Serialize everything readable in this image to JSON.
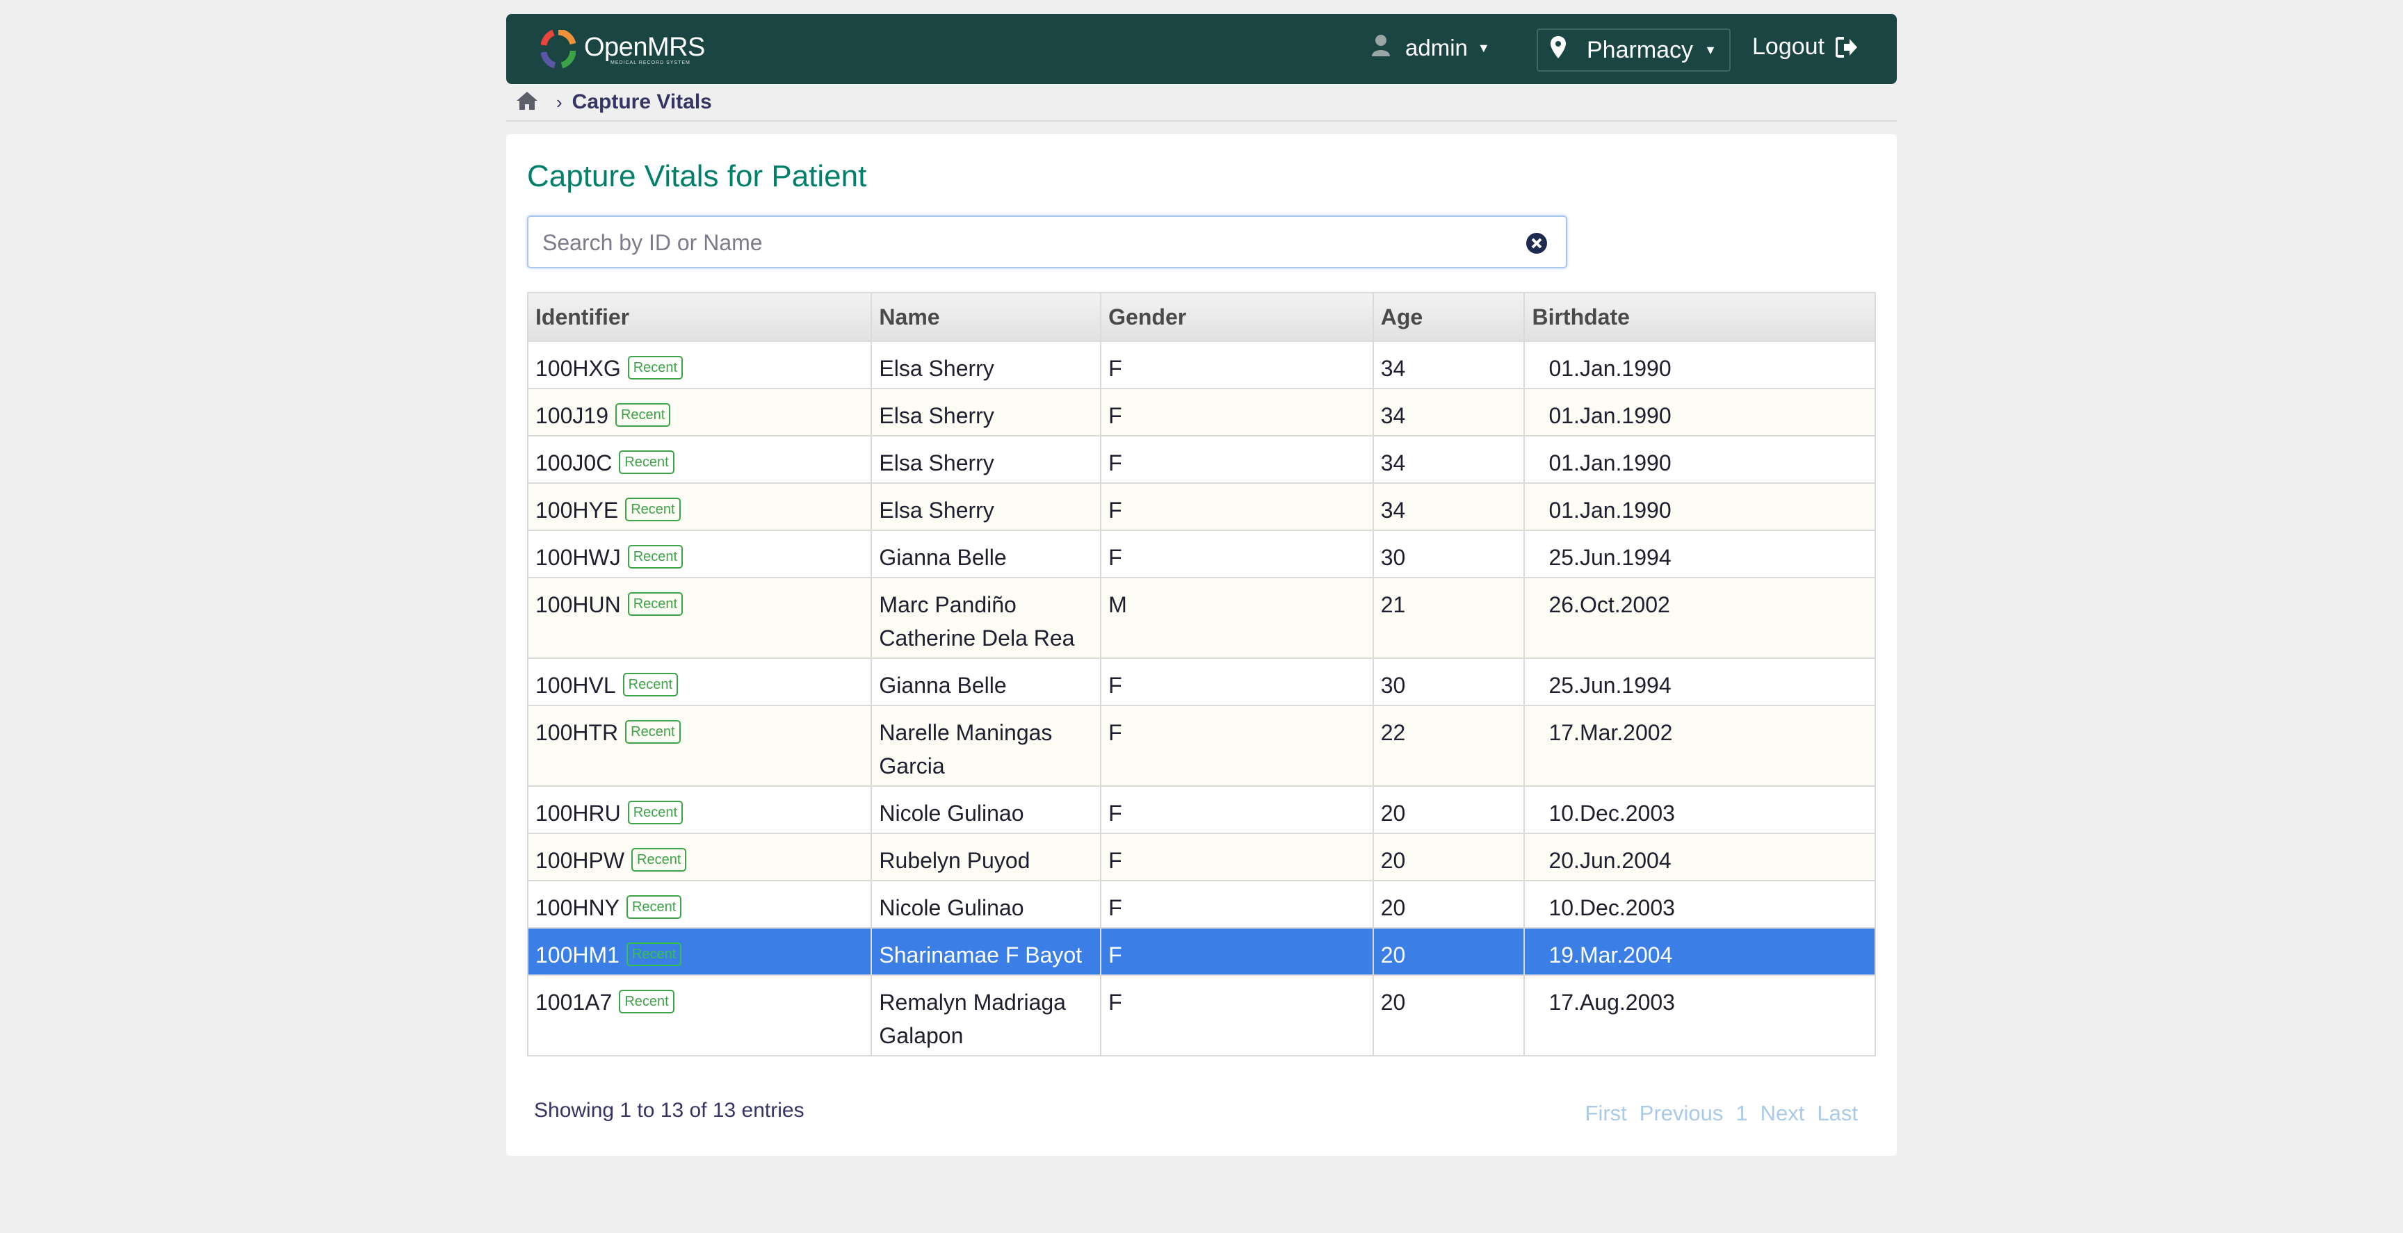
{
  "header": {
    "logo_text": "OpenMRS",
    "logo_tagline": "MEDICAL RECORD SYSTEM",
    "user": "admin",
    "location": "Pharmacy",
    "logout": "Logout"
  },
  "breadcrumb": {
    "current": "Capture Vitals"
  },
  "page": {
    "title": "Capture Vitals for Patient",
    "search_placeholder": "Search by ID or Name"
  },
  "table": {
    "headers": [
      "Identifier",
      "Name",
      "Gender",
      "Age",
      "Birthdate"
    ],
    "badge": "Recent",
    "rows": [
      {
        "id": "100HXG",
        "name": "Elsa Sherry",
        "gender": "F",
        "age": "34",
        "birthdate": "01.Jan.1990"
      },
      {
        "id": "100J19",
        "name": "Elsa Sherry",
        "gender": "F",
        "age": "34",
        "birthdate": "01.Jan.1990"
      },
      {
        "id": "100J0C",
        "name": "Elsa Sherry",
        "gender": "F",
        "age": "34",
        "birthdate": "01.Jan.1990"
      },
      {
        "id": "100HYE",
        "name": "Elsa Sherry",
        "gender": "F",
        "age": "34",
        "birthdate": "01.Jan.1990"
      },
      {
        "id": "100HWJ",
        "name": "Gianna Belle",
        "gender": "F",
        "age": "30",
        "birthdate": "25.Jun.1994"
      },
      {
        "id": "100HUN",
        "name": "Marc Pandiño Catherine Dela Rea",
        "gender": "M",
        "age": "21",
        "birthdate": "26.Oct.2002"
      },
      {
        "id": "100HVL",
        "name": "Gianna Belle",
        "gender": "F",
        "age": "30",
        "birthdate": "25.Jun.1994"
      },
      {
        "id": "100HTR",
        "name": "Narelle Maningas Garcia",
        "gender": "F",
        "age": "22",
        "birthdate": "17.Mar.2002"
      },
      {
        "id": "100HRU",
        "name": "Nicole Gulinao",
        "gender": "F",
        "age": "20",
        "birthdate": "10.Dec.2003"
      },
      {
        "id": "100HPW",
        "name": "Rubelyn Puyod",
        "gender": "F",
        "age": "20",
        "birthdate": "20.Jun.2004"
      },
      {
        "id": "100HNY",
        "name": "Nicole Gulinao",
        "gender": "F",
        "age": "20",
        "birthdate": "10.Dec.2003"
      },
      {
        "id": "100HM1",
        "name": "Sharinamae F Bayot",
        "gender": "F",
        "age": "20",
        "birthdate": "19.Mar.2004"
      },
      {
        "id": "1001A7",
        "name": "Remalyn Madriaga Galapon",
        "gender": "F",
        "age": "20",
        "birthdate": "17.Aug.2003"
      }
    ]
  },
  "footer": {
    "info": "Showing 1 to 13 of 13 entries",
    "pager": {
      "first": "First",
      "previous": "Previous",
      "page": "1",
      "next": "Next",
      "last": "Last"
    }
  },
  "colors": {
    "header_bg": "#1b4542",
    "title": "#00806b",
    "selected_row": "#3b7ee5",
    "badge": "#3da347"
  },
  "icons": [
    "user-icon",
    "map-marker-icon",
    "logout-icon",
    "home-icon",
    "chevron-right-icon",
    "clear-search-icon"
  ]
}
